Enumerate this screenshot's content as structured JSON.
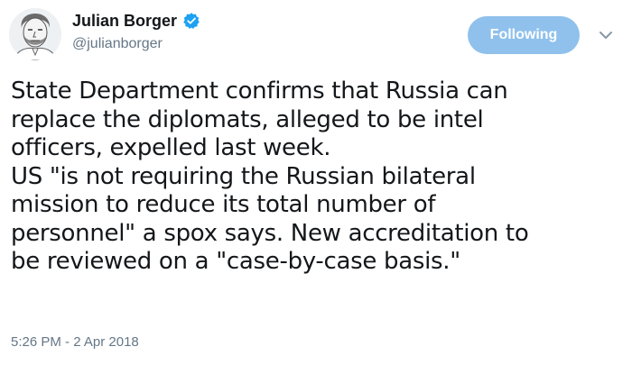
{
  "author": {
    "display_name": "Julian Borger",
    "handle": "@julianborger",
    "verified": true,
    "avatar_icon": "sketch-portrait-avatar"
  },
  "follow_button": {
    "label": "Following",
    "color": "#8fc1ec"
  },
  "menu": {
    "icon": "chevron-down-icon"
  },
  "tweet": {
    "lines": [
      "State Department confirms that Russia can",
      "replace the diplomats, alleged to be intel",
      "officers, expelled last week.",
      "US \"is not requiring the Russian bilateral",
      "mission to reduce its total number of",
      "personnel\" a spox says. New accreditation to",
      "be reviewed on a \"case-by-case basis.\""
    ],
    "timestamp": "5:26 PM - 2 Apr 2018"
  },
  "colors": {
    "text": "#14171a",
    "secondary": "#657786",
    "verified_badge": "#1da1f2"
  }
}
